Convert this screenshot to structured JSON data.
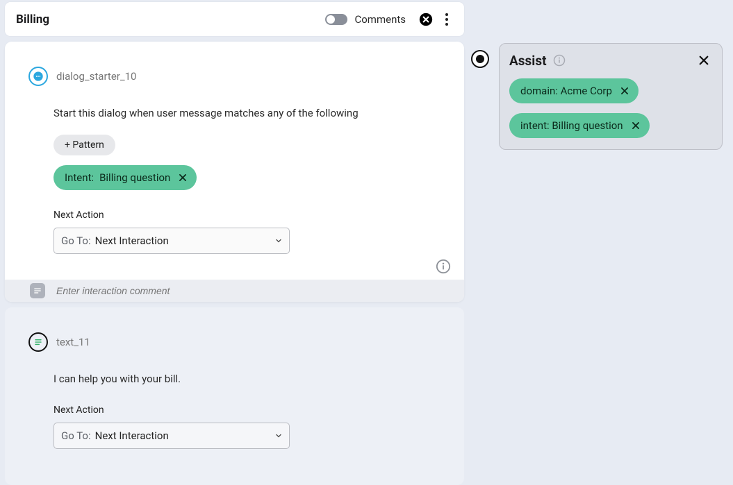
{
  "header": {
    "title": "Billing",
    "comments_label": "Comments"
  },
  "card1": {
    "name": "dialog_starter_10",
    "instruction": "Start this dialog when user message matches any of the following",
    "add_pattern_label": "+ Pattern",
    "intent_key_label": "Intent:",
    "intent_value": "Billing question",
    "next_action_label": "Next Action",
    "select_prefix": "Go To:",
    "select_value": "Next Interaction",
    "comment_placeholder": "Enter interaction comment"
  },
  "card2": {
    "name": "text_11",
    "text": "I can help you with your bill.",
    "next_action_label": "Next Action",
    "select_prefix": "Go To:",
    "select_value": "Next Interaction"
  },
  "assist": {
    "title": "Assist",
    "chips": [
      "domain: Acme Corp",
      "intent: Billing question"
    ]
  }
}
